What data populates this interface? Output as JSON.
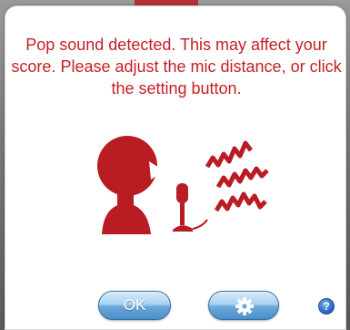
{
  "dialog": {
    "message": "Pop sound detected. This may affect your score. Please adjust the mic distance, or click the setting button.",
    "illustration_icon": "speaker-pop-microphone-icon"
  },
  "buttons": {
    "ok_label": "OK",
    "settings_icon": "gear-icon",
    "help_icon": "question-mark-icon",
    "help_label": "?"
  },
  "colors": {
    "message": "#c51f25",
    "illustration": "#b91c22",
    "button_blue": "#4b8fcb"
  }
}
